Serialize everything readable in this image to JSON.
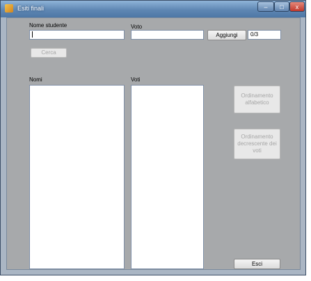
{
  "window": {
    "title": "Esiti finali"
  },
  "form": {
    "name_label": "Nome studente",
    "grade_label": "Voto",
    "name_value": "",
    "grade_value": "",
    "add_button": "Aggiungi",
    "counter": "0/3",
    "search_button": "Cerca",
    "names_label": "Nomi",
    "grades_label": "Voti",
    "sort_alpha_button": "Ordinamento alfabetico",
    "sort_grades_button": "Ordinamento decrescente dei voti",
    "exit_button": "Esci"
  },
  "window_controls": {
    "minimize": "–",
    "maximize": "□",
    "close": "x"
  },
  "colors": {
    "form_background": "#a7a9ab",
    "titlebar": "#5f87b3",
    "close_button": "#c0372b"
  }
}
